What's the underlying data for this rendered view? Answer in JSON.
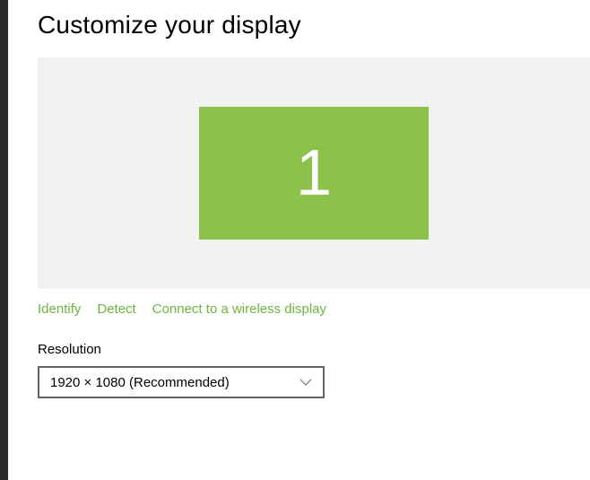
{
  "header": {
    "title": "Customize your display"
  },
  "display": {
    "monitors": [
      {
        "number": "1"
      }
    ]
  },
  "links": {
    "identify": "Identify",
    "detect": "Detect",
    "connect_wireless": "Connect to a wireless display"
  },
  "resolution": {
    "label": "Resolution",
    "selected": "1920 × 1080 (Recommended)"
  }
}
